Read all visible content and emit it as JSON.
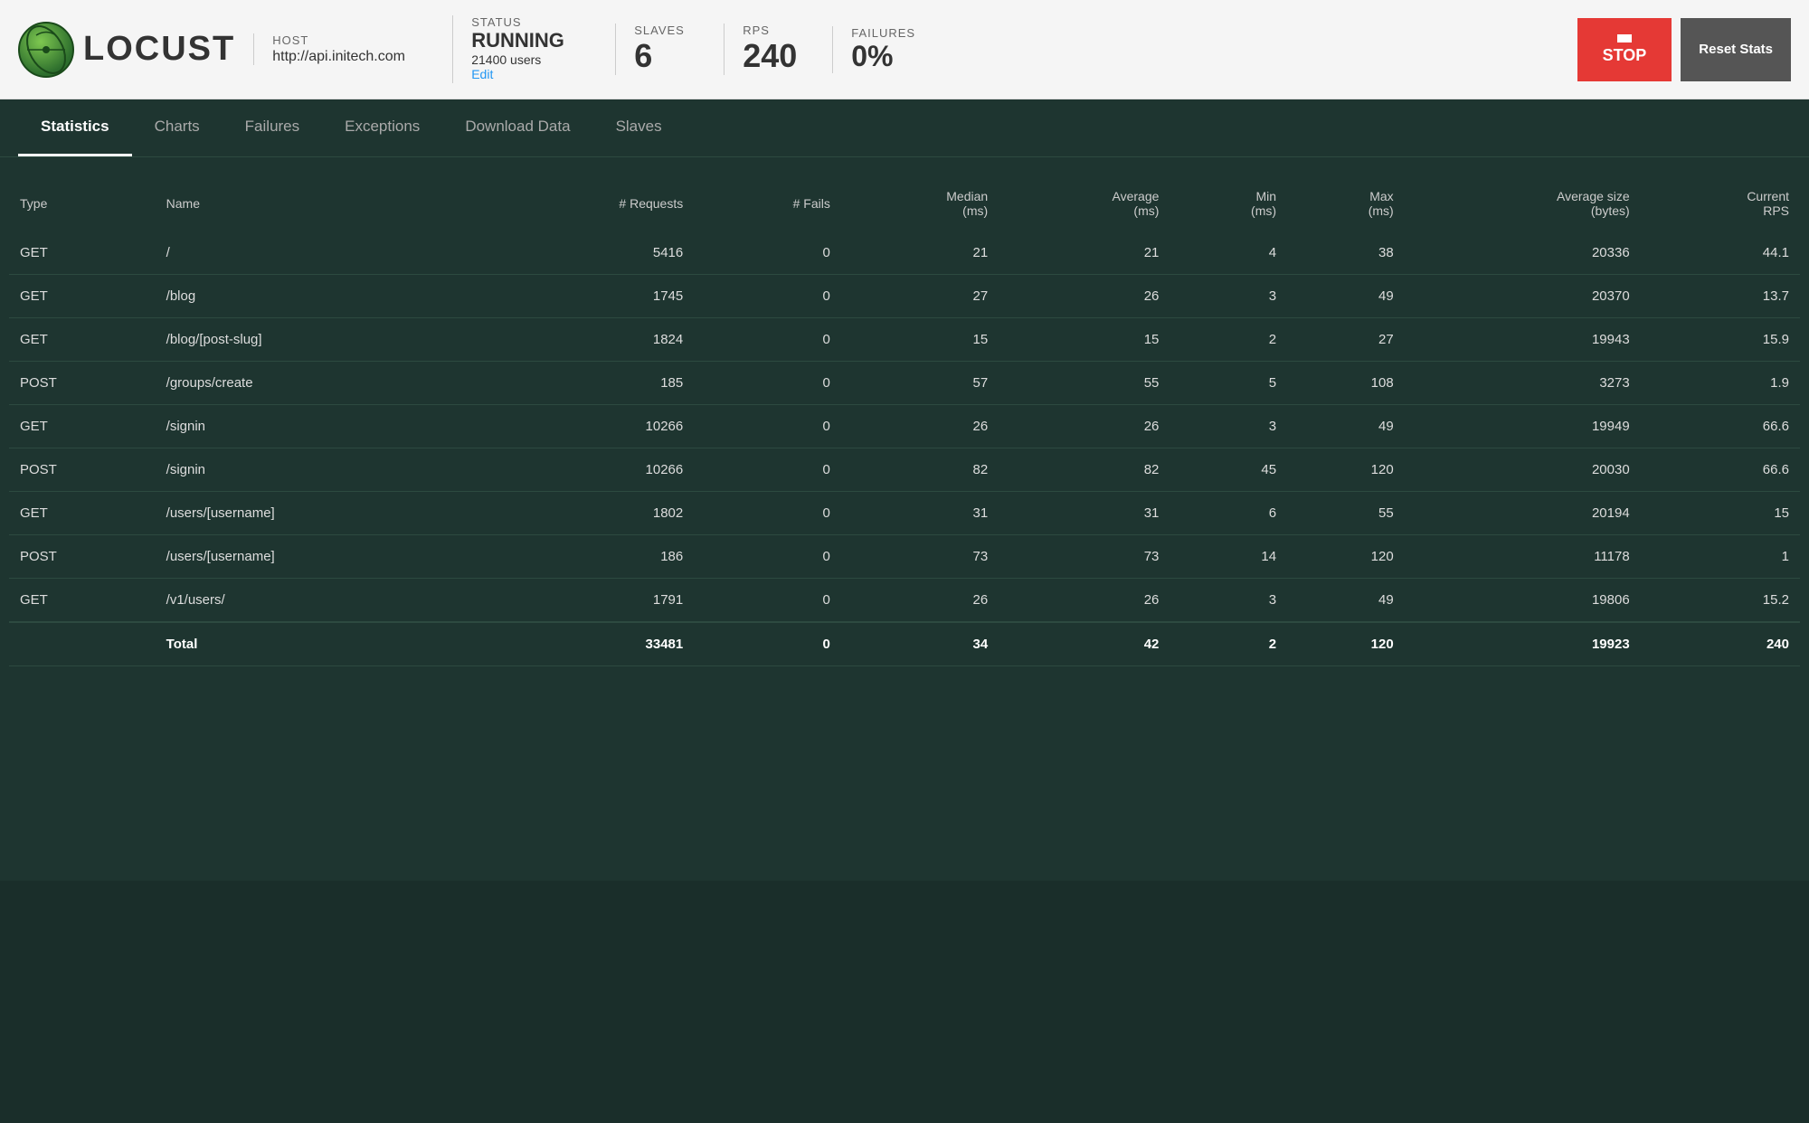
{
  "header": {
    "logo_text": "LOCUST",
    "host_label": "HOST",
    "host_value": "http://api.initech.com",
    "status_label": "STATUS",
    "status_value": "RUNNING",
    "status_users": "21400 users",
    "status_edit": "Edit",
    "slaves_label": "SLAVES",
    "slaves_value": "6",
    "rps_label": "RPS",
    "rps_value": "240",
    "failures_label": "FAILURES",
    "failures_value": "0%",
    "stop_label": "STOP",
    "reset_label": "Reset Stats"
  },
  "nav": {
    "tabs": [
      {
        "label": "Statistics",
        "active": true
      },
      {
        "label": "Charts",
        "active": false
      },
      {
        "label": "Failures",
        "active": false
      },
      {
        "label": "Exceptions",
        "active": false
      },
      {
        "label": "Download Data",
        "active": false
      },
      {
        "label": "Slaves",
        "active": false
      }
    ]
  },
  "table": {
    "columns": [
      "Type",
      "Name",
      "# Requests",
      "# Fails",
      "Median\n(ms)",
      "Average\n(ms)",
      "Min\n(ms)",
      "Max\n(ms)",
      "Average size\n(bytes)",
      "Current\nRPS"
    ],
    "rows": [
      {
        "type": "GET",
        "name": "/",
        "requests": "5416",
        "fails": "0",
        "median": "21",
        "average": "21",
        "min": "4",
        "max": "38",
        "avg_size": "20336",
        "rps": "44.1"
      },
      {
        "type": "GET",
        "name": "/blog",
        "requests": "1745",
        "fails": "0",
        "median": "27",
        "average": "26",
        "min": "3",
        "max": "49",
        "avg_size": "20370",
        "rps": "13.7"
      },
      {
        "type": "GET",
        "name": "/blog/[post-slug]",
        "requests": "1824",
        "fails": "0",
        "median": "15",
        "average": "15",
        "min": "2",
        "max": "27",
        "avg_size": "19943",
        "rps": "15.9"
      },
      {
        "type": "POST",
        "name": "/groups/create",
        "requests": "185",
        "fails": "0",
        "median": "57",
        "average": "55",
        "min": "5",
        "max": "108",
        "avg_size": "3273",
        "rps": "1.9"
      },
      {
        "type": "GET",
        "name": "/signin",
        "requests": "10266",
        "fails": "0",
        "median": "26",
        "average": "26",
        "min": "3",
        "max": "49",
        "avg_size": "19949",
        "rps": "66.6"
      },
      {
        "type": "POST",
        "name": "/signin",
        "requests": "10266",
        "fails": "0",
        "median": "82",
        "average": "82",
        "min": "45",
        "max": "120",
        "avg_size": "20030",
        "rps": "66.6"
      },
      {
        "type": "GET",
        "name": "/users/[username]",
        "requests": "1802",
        "fails": "0",
        "median": "31",
        "average": "31",
        "min": "6",
        "max": "55",
        "avg_size": "20194",
        "rps": "15"
      },
      {
        "type": "POST",
        "name": "/users/[username]",
        "requests": "186",
        "fails": "0",
        "median": "73",
        "average": "73",
        "min": "14",
        "max": "120",
        "avg_size": "11178",
        "rps": "1"
      },
      {
        "type": "GET",
        "name": "/v1/users/",
        "requests": "1791",
        "fails": "0",
        "median": "26",
        "average": "26",
        "min": "3",
        "max": "49",
        "avg_size": "19806",
        "rps": "15.2"
      }
    ],
    "total": {
      "label": "Total",
      "requests": "33481",
      "fails": "0",
      "median": "34",
      "average": "42",
      "min": "2",
      "max": "120",
      "avg_size": "19923",
      "rps": "240"
    }
  }
}
